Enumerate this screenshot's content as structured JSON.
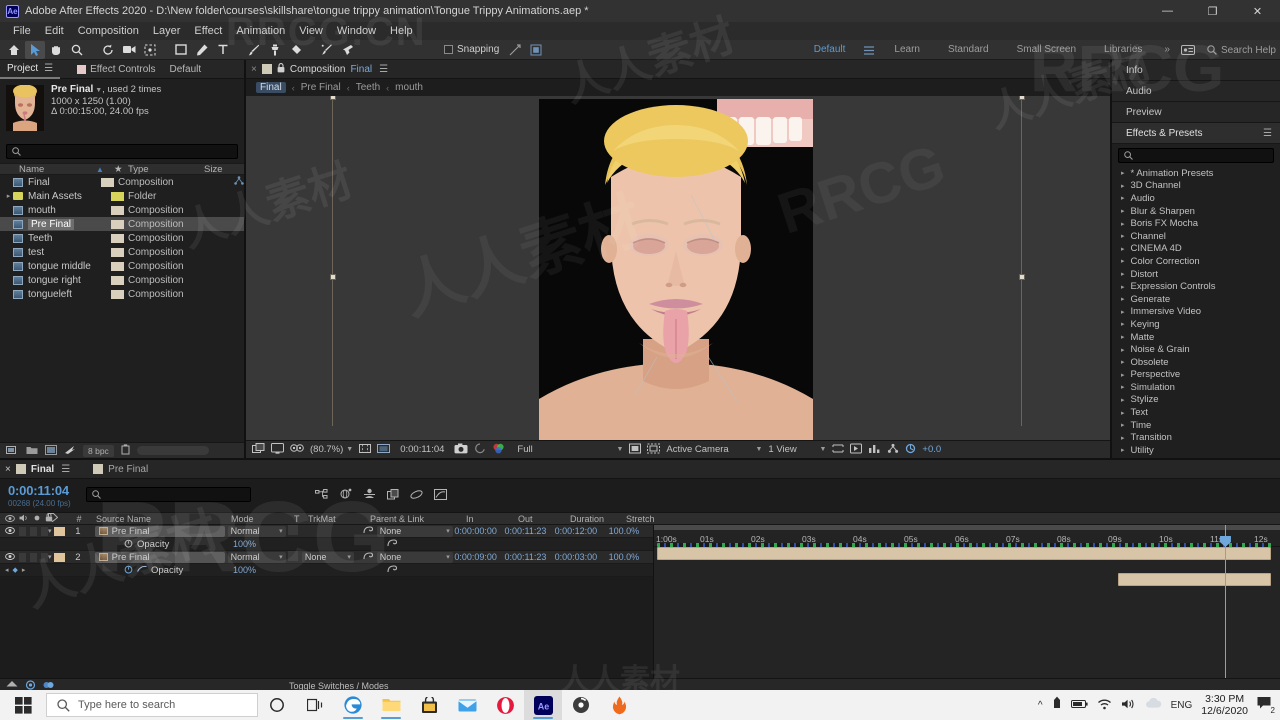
{
  "window": {
    "title": "Adobe After Effects 2020 - D:\\New folder\\courses\\skillshare\\tongue trippy animation\\Tongue Trippy Animations.aep *",
    "logo": "Ae",
    "minimize": "—",
    "maximize": "❐",
    "close": "✕"
  },
  "menu": [
    "File",
    "Edit",
    "Composition",
    "Layer",
    "Effect",
    "Animation",
    "View",
    "Window",
    "Help"
  ],
  "toolbar": {
    "snapping_label": "Snapping",
    "workspaces": [
      {
        "label": "Default",
        "active": true
      },
      {
        "label": "Learn",
        "active": false
      },
      {
        "label": "Standard",
        "active": false
      },
      {
        "label": "Small Screen",
        "active": false
      },
      {
        "label": "Libraries",
        "active": false
      }
    ],
    "overflow": "»",
    "search_help": "Search Help"
  },
  "project": {
    "tabs": [
      {
        "label": "Project",
        "active": true
      },
      {
        "label": "Effect Controls",
        "active": false
      },
      {
        "label": "Default",
        "active": false
      }
    ],
    "selected_item": {
      "name": "Pre Final",
      "usage": ", used 2 times",
      "resolution": "1000 x 1250 (1.00)",
      "duration": "Δ 0:00:15:00, 24.00 fps"
    },
    "search_placeholder": "",
    "columns": {
      "name": "Name",
      "type": "Type",
      "size": "Size"
    },
    "items": [
      {
        "name": "Final",
        "type": "Composition",
        "size": "",
        "kind": "comp",
        "expandable": false,
        "selected": false,
        "shared": true
      },
      {
        "name": "Main Assets",
        "type": "Folder",
        "size": "",
        "kind": "folder",
        "expandable": true,
        "selected": false,
        "shared": false
      },
      {
        "name": "mouth",
        "type": "Composition",
        "size": "",
        "kind": "comp",
        "expandable": false,
        "selected": false,
        "shared": false
      },
      {
        "name": "Pre Final",
        "type": "Composition",
        "size": "",
        "kind": "comp",
        "expandable": false,
        "selected": true,
        "shared": false
      },
      {
        "name": "Teeth",
        "type": "Composition",
        "size": "",
        "kind": "comp",
        "expandable": false,
        "selected": false,
        "shared": false
      },
      {
        "name": "test",
        "type": "Composition",
        "size": "",
        "kind": "comp",
        "expandable": false,
        "selected": false,
        "shared": false
      },
      {
        "name": "tongue middle",
        "type": "Composition",
        "size": "",
        "kind": "comp",
        "expandable": false,
        "selected": false,
        "shared": false
      },
      {
        "name": "tongue right",
        "type": "Composition",
        "size": "",
        "kind": "comp",
        "expandable": false,
        "selected": false,
        "shared": false
      },
      {
        "name": "tongueleft",
        "type": "Composition",
        "size": "",
        "kind": "comp",
        "expandable": false,
        "selected": false,
        "shared": false
      }
    ],
    "bitdepth": "8 bpc"
  },
  "composition": {
    "tab_label": "Composition",
    "tab_name": "Final",
    "breadcrumbs": [
      {
        "label": "Final",
        "active": true
      },
      {
        "label": "Pre Final",
        "active": false
      },
      {
        "label": "Teeth",
        "active": false
      },
      {
        "label": "mouth",
        "active": false
      }
    ],
    "zoom": "(80.7%)",
    "timecode": "0:00:11:04",
    "resolution": "Full",
    "camera": "Active Camera",
    "views": "1 View",
    "exposure": "+0.0"
  },
  "rail": {
    "panels": [
      {
        "label": "Info",
        "selected": false
      },
      {
        "label": "Audio",
        "selected": false
      },
      {
        "label": "Preview",
        "selected": false
      },
      {
        "label": "Effects & Presets",
        "selected": true
      }
    ],
    "search_placeholder": "",
    "categories": [
      "* Animation Presets",
      "3D Channel",
      "Audio",
      "Blur & Sharpen",
      "Boris FX Mocha",
      "Channel",
      "CINEMA 4D",
      "Color Correction",
      "Distort",
      "Expression Controls",
      "Generate",
      "Immersive Video",
      "Keying",
      "Matte",
      "Noise & Grain",
      "Obsolete",
      "Perspective",
      "Simulation",
      "Stylize",
      "Text",
      "Time",
      "Transition",
      "Utility"
    ]
  },
  "timeline": {
    "tabs": [
      {
        "label": "Final",
        "active": true
      },
      {
        "label": "Pre Final",
        "active": false
      }
    ],
    "current_time": "0:00:11:04",
    "current_frame": "00268 (24.00 fps)",
    "search_placeholder": "",
    "columns": [
      "#",
      "Source Name",
      "Mode",
      "T",
      "TrkMat",
      "Parent & Link",
      "In",
      "Out",
      "Duration",
      "Stretch"
    ],
    "layers": [
      {
        "index": "1",
        "source_name": "Pre Final",
        "mode": "Normal",
        "trkmat": "",
        "parent": "None",
        "in": "0:00:00:00",
        "out": "0:00:11:23",
        "duration": "0:00:12:00",
        "stretch": "100.0%",
        "property": {
          "name": "Opacity",
          "value": "100%"
        },
        "bar_start_pct": 0.0,
        "bar_end_pct": 99.7
      },
      {
        "index": "2",
        "source_name": "Pre Final",
        "mode": "Normal",
        "trkmat": "None",
        "parent": "None",
        "in": "0:00:09:00",
        "out": "0:00:11:23",
        "duration": "0:00:03:00",
        "stretch": "100.0%",
        "property": {
          "name": "Opacity",
          "value": "100%"
        },
        "bar_start_pct": 74.8,
        "bar_end_pct": 99.7
      }
    ],
    "ruler_ticks": [
      "1:00s",
      "01s",
      "02s",
      "03s",
      "04s",
      "05s",
      "06s",
      "07s",
      "08s",
      "09s",
      "10s",
      "11s",
      "12s"
    ],
    "playhead_pct": 92.2,
    "footer": "Toggle Switches / Modes"
  },
  "taskbar": {
    "search_placeholder": "Type here to search",
    "language": "ENG",
    "time": "3:30 PM",
    "date": "12/6/2020",
    "notification_count": "2"
  },
  "watermarks": {
    "brand": "RRCG.CN",
    "cn_text": "人人素材",
    "rrcg": "RRCG"
  }
}
